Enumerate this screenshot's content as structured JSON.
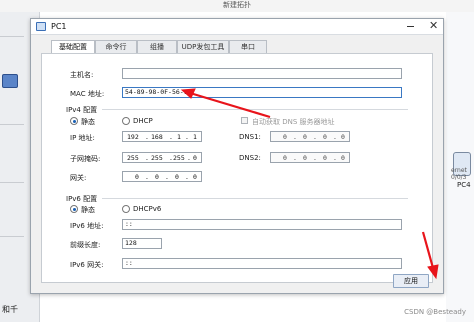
{
  "app": {
    "window_title": "新建拓扑"
  },
  "background": {
    "left_text": "和千",
    "device_label": "PC4",
    "device_net_label": "ernet 0/0/3"
  },
  "dialog": {
    "title": "PC1",
    "tabs": [
      "基础配置",
      "命令行",
      "组播",
      "UDP发包工具",
      "串口"
    ],
    "active_tab": 0
  },
  "basic": {
    "hostname_label": "主机名:",
    "hostname_value": "",
    "mac_label": "MAC 地址:",
    "mac_value": "54-89-98-0F-56-11"
  },
  "ipv4": {
    "section_label": "IPv4 配置",
    "static_label": "静态",
    "dhcp_label": "DHCP",
    "selected": "static",
    "auto_dns_label": "自动获取 DNS 服务器地址",
    "ip_label": "IP 地址:",
    "ip": [
      "192",
      "168",
      "1",
      "1"
    ],
    "mask_label": "子网掩码:",
    "mask": [
      "255",
      "255",
      "255",
      "0"
    ],
    "gateway_label": "网关:",
    "gateway": [
      "0",
      "0",
      "0",
      "0"
    ],
    "dns1_label": "DNS1:",
    "dns1": [
      "0",
      "0",
      "0",
      "0"
    ],
    "dns2_label": "DNS2:",
    "dns2": [
      "0",
      "0",
      "0",
      "0"
    ]
  },
  "ipv6": {
    "section_label": "IPv6 配置",
    "static_label": "静态",
    "dhcp_label": "DHCPv6",
    "selected": "static",
    "addr_label": "IPv6 地址:",
    "addr_value": "::",
    "prefix_label": "前缀长度:",
    "prefix_value": "128",
    "gateway_label": "IPv6 网关:",
    "gateway_value": "::"
  },
  "buttons": {
    "apply": "应用"
  },
  "watermark": "CSDN @Besteady",
  "colors": {
    "accent": "#1a5fb4",
    "annotation_arrow": "#e8141b"
  }
}
